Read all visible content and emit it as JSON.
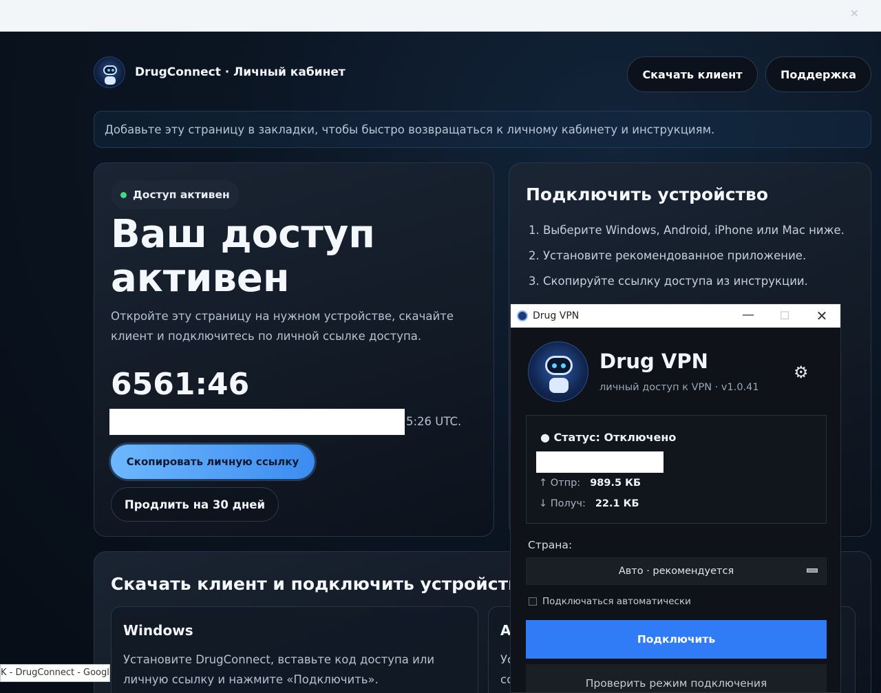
{
  "browser": {
    "close_glyph": "✕"
  },
  "header": {
    "brand": "DrugConnect · Личный кабинет",
    "download_button": "Скачать клиент",
    "support_button": "Поддержка"
  },
  "notice": "Добавьте эту страницу в закладки, чтобы быстро возвращаться к личному кабинету и инструкциям.",
  "access": {
    "badge": "Доступ активен",
    "title": "Ваш доступ активен",
    "description": "Откройте эту страницу на нужном устройстве, скачайте клиент и подключитесь по личной ссылке доступа.",
    "timer": "6561:46",
    "expiry_visible": "5:26 UTC.",
    "copy_button": "Скопировать личную ссылку",
    "extend_button": "Продлить на 30 дней"
  },
  "connect": {
    "title": "Подключить устройство",
    "steps": [
      "1. Выберите Windows, Android, iPhone или Mac ниже.",
      "2. Установите рекомендованное приложение.",
      "3. Скопируйте ссылку доступа из инструкции."
    ]
  },
  "downloads": {
    "title": "Скачать клиент и подключить устройство",
    "windows": {
      "title": "Windows",
      "description": "Установите DrugConnect, вставьте код доступа или личную ссылку и нажмите «Подключить»."
    },
    "other": {
      "title": "A",
      "description": "Ус сс"
    }
  },
  "tooltip": "K - DrugConnect - Google",
  "vpn_window": {
    "window_title": "Drug VPN",
    "app_title": "Drug VPN",
    "subtitle": "личный доступ к VPN · v1.0.41",
    "status": "● Статус: Отключено",
    "sent_label": "↑ Отпр:",
    "sent_value": "989.5 КБ",
    "received_label": "↓ Получ:",
    "received_value": "22.1 КБ",
    "country_label": "Страна:",
    "country_value": "Авто · рекомендуется",
    "auto_connect": "Подключаться автоматически",
    "connect_button": "Подключить",
    "check_button": "Проверить режим подключения"
  },
  "colors": {
    "accent_blue": "#2f7cf6",
    "active_green": "#3ddc84",
    "background": "#0b1522"
  },
  "icons": [
    "robot-logo-icon",
    "settings-gear-icon",
    "minimize-icon",
    "maximize-icon",
    "close-icon"
  ]
}
